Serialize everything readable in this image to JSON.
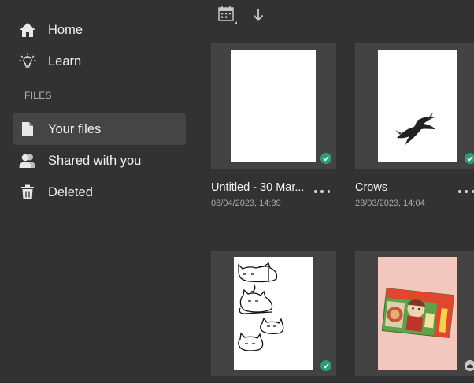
{
  "sidebar": {
    "items": [
      {
        "label": "Home",
        "icon": "home-icon"
      },
      {
        "label": "Learn",
        "icon": "lightbulb-icon"
      }
    ],
    "section_label": "FILES",
    "file_items": [
      {
        "label": "Your files",
        "icon": "file-icon",
        "active": true
      },
      {
        "label": "Shared with you",
        "icon": "people-icon",
        "active": false
      },
      {
        "label": "Deleted",
        "icon": "trash-icon",
        "active": false
      }
    ]
  },
  "toolbar": {
    "sort_icon": "calendar-icon",
    "direction_icon": "arrow-down-icon"
  },
  "files": [
    {
      "title": "Untitled - 30 Mar...",
      "date": "08/04/2023, 14:39",
      "status": "synced"
    },
    {
      "title": "Crows",
      "date": "23/03/2023, 14:04",
      "status": "synced"
    },
    {
      "title": "",
      "date": "",
      "status": "synced"
    },
    {
      "title": "",
      "date": "",
      "status": "cloud"
    }
  ],
  "colors": {
    "background": "#323232",
    "card": "#434343",
    "active_nav": "#454545",
    "synced_badge": "#2d9d78"
  }
}
